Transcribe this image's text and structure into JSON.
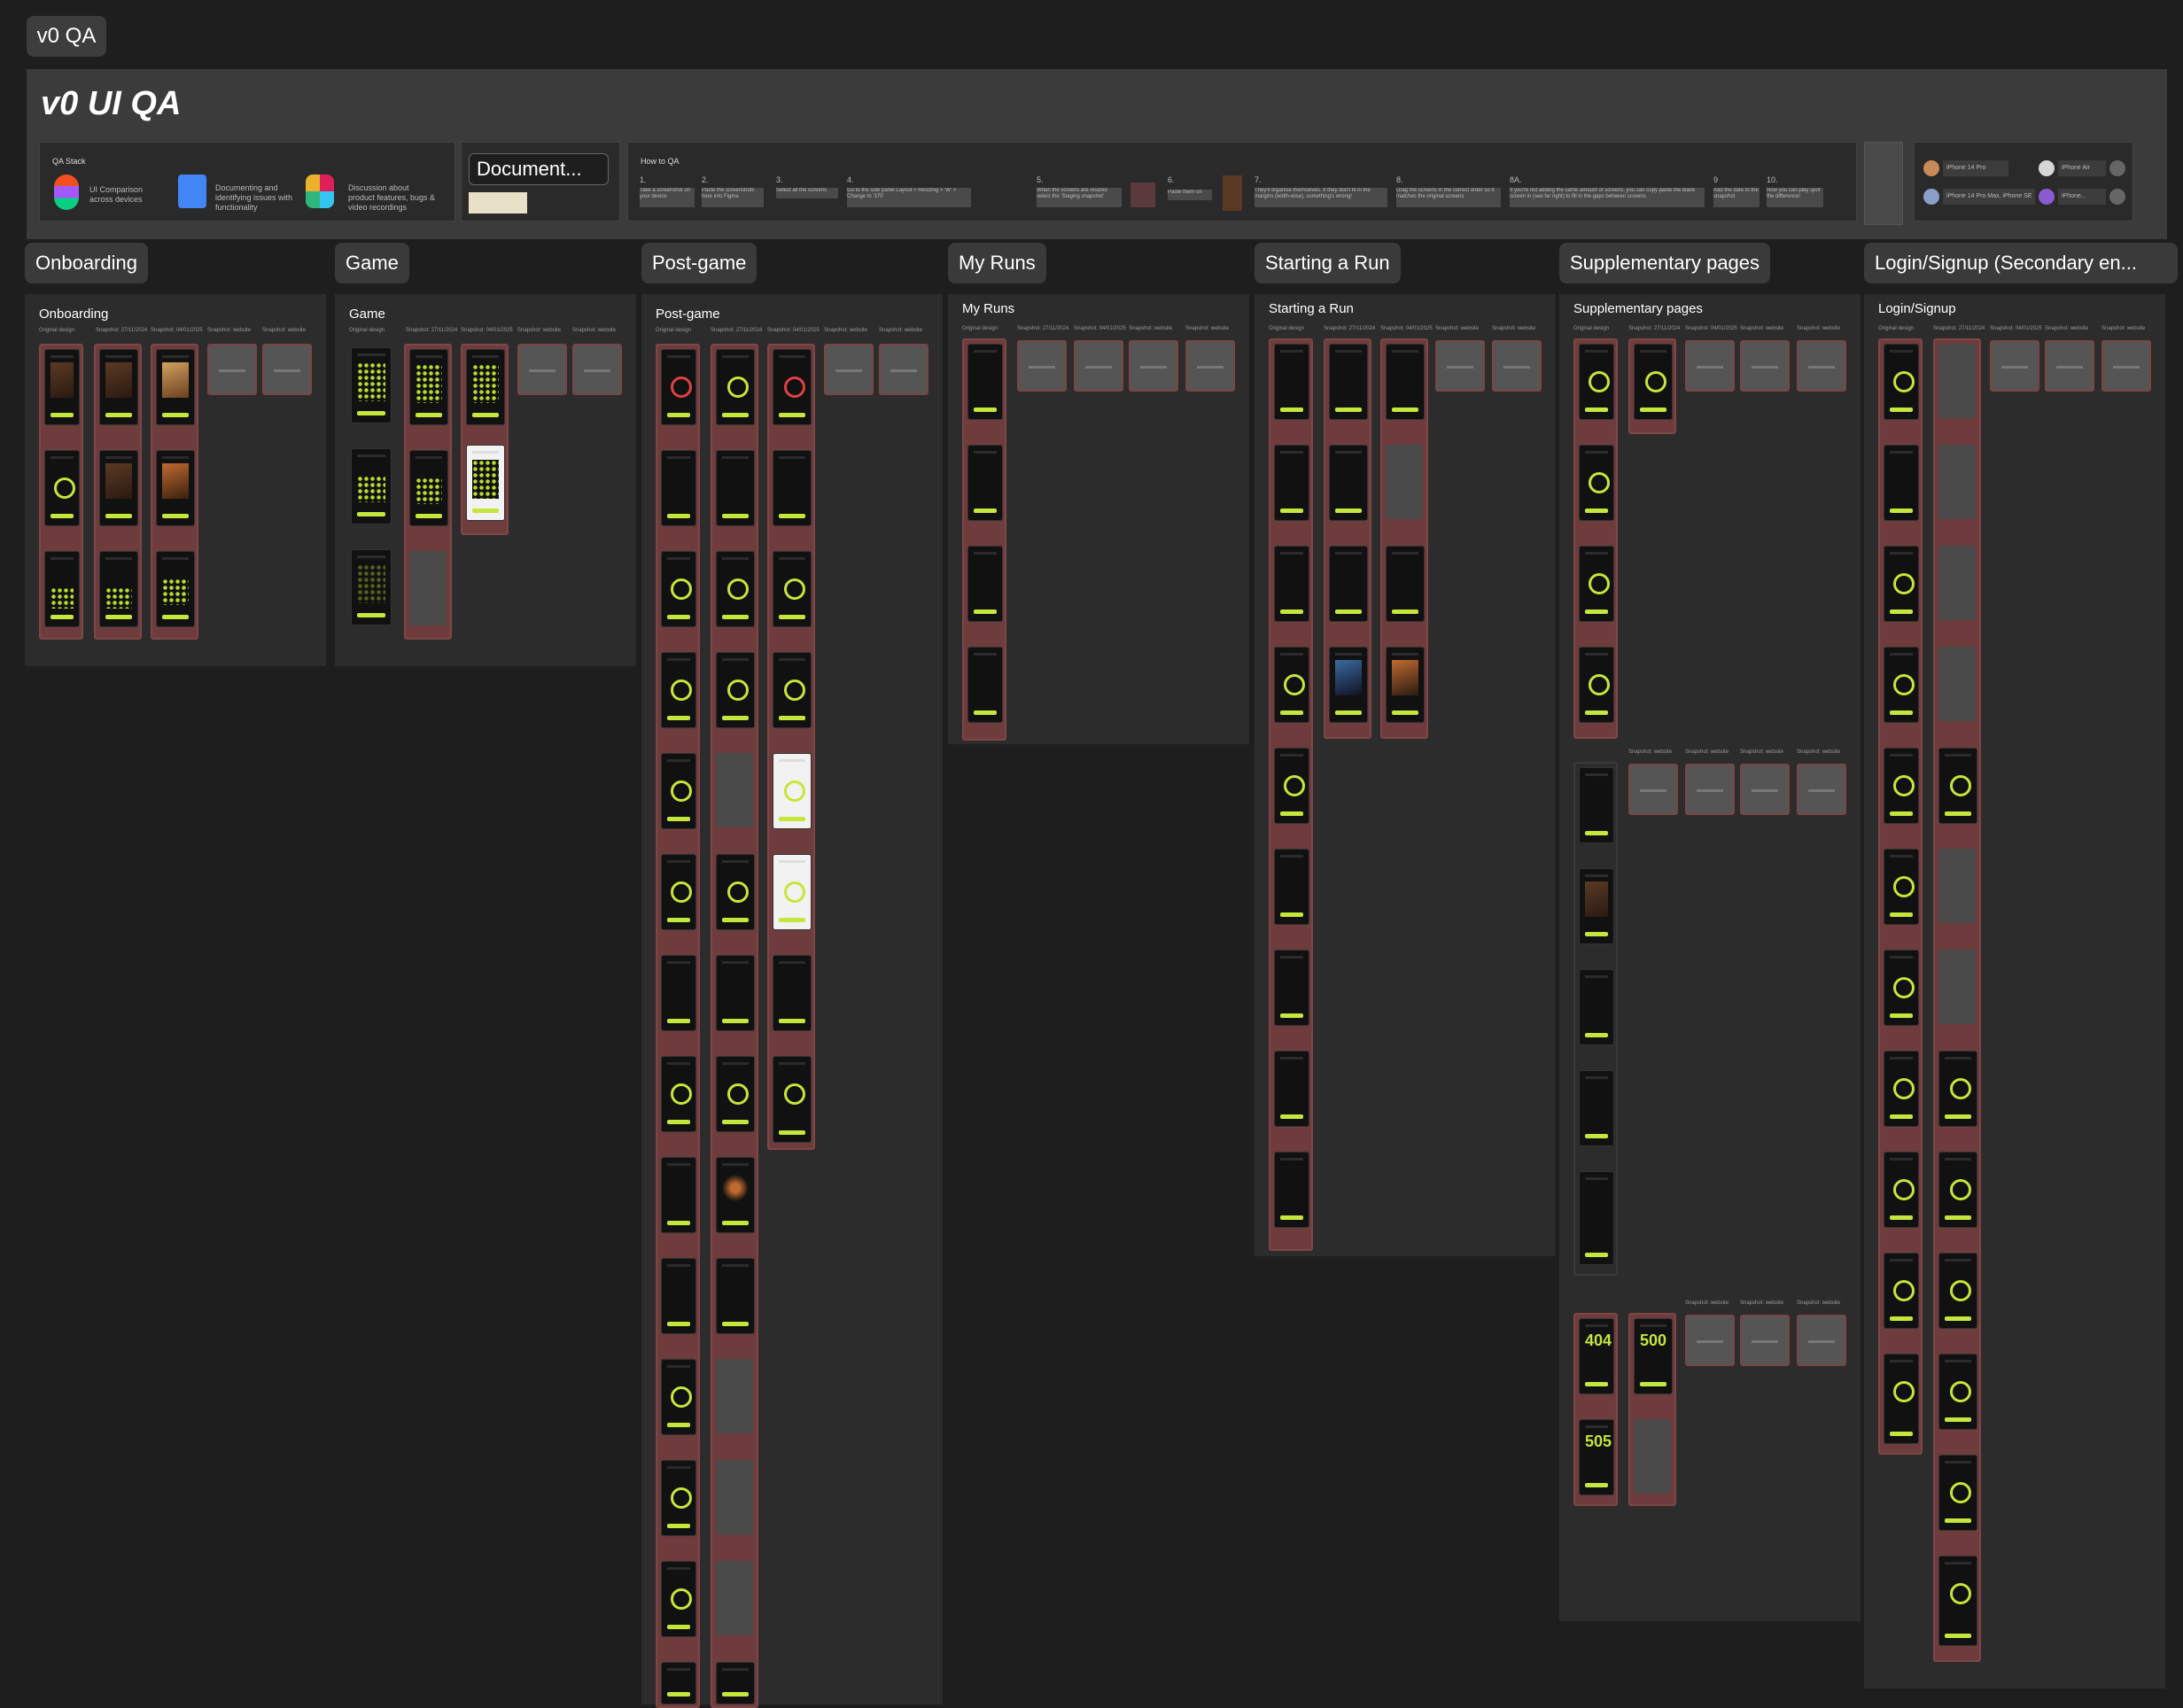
{
  "page": {
    "tag": "v0 QA"
  },
  "banner": {
    "title": "v0 UI QA",
    "qa_stack": {
      "title": "QA Stack",
      "tools": [
        {
          "icon": "figma-icon",
          "desc": "UI Comparison across devices"
        },
        {
          "icon": "google-docs-icon",
          "desc": "Documenting and identifying issues with functionality"
        },
        {
          "icon": "slack-icon",
          "desc": "Discussion about product features, bugs & video recordings"
        }
      ]
    },
    "document": {
      "label": "Document..."
    },
    "how_to": {
      "title": "How to QA",
      "steps": [
        {
          "num": "1.",
          "text": "Take a screenshot on your device"
        },
        {
          "num": "2.",
          "text": "Paste the screenshots here into Figma"
        },
        {
          "num": "3.",
          "text": "Select all the screens"
        },
        {
          "num": "4.",
          "text": "Go to the side panel Layout > Resizing > 'W' > Change to '375'"
        },
        {
          "num": "5.",
          "text": "When the screens are resized select the 'Staging snapshot'"
        },
        {
          "num": "6.",
          "text": "Paste them on"
        },
        {
          "num": "7.",
          "text": "They'll organise themselves. If they don't fit in the margins (width-wise), something's wrong!"
        },
        {
          "num": "8.",
          "text": "Drag the screens in the correct order so it matches the original screens"
        },
        {
          "num": "8A.",
          "text": "If you're not adding the same amount of screens, you can copy paste the blank screen in (see far right) to fill in the gaps between screens"
        },
        {
          "num": "9",
          "text": "Add the date to the snapshot"
        },
        {
          "num": "10.",
          "text": "Now you can play spot the difference!"
        }
      ]
    },
    "devices": [
      {
        "label": "iPhone 14 Pro"
      },
      {
        "label": "iPhone Air"
      },
      {
        "label": "iPhone 14 Pro Max, iPhone SE"
      },
      {
        "label": "iPhone..."
      }
    ]
  },
  "sections": [
    {
      "tag": "Onboarding",
      "panel_title": "Onboarding"
    },
    {
      "tag": "Game",
      "panel_title": "Game"
    },
    {
      "tag": "Post-game",
      "panel_title": "Post-game"
    },
    {
      "tag": "My Runs",
      "panel_title": "My Runs"
    },
    {
      "tag": "Starting a Run",
      "panel_title": "Starting a Run"
    },
    {
      "tag": "Supplementary pages",
      "panel_title": "Supplementary pages"
    },
    {
      "tag": "Login/Signup (Secondary en...",
      "panel_title": "Login/Signup"
    }
  ],
  "column_headers": {
    "original": "Original design",
    "snapshot_a": "Snapshot: 27/11/2024",
    "snapshot_b": "Snapshot: 04/01/2025",
    "snapshot_c": "Snapshot: website",
    "snapshot_d": "Snapshot: website"
  },
  "error_codes": {
    "e404": "404",
    "e500": "500",
    "e505": "505"
  },
  "colors": {
    "accent": "#c5e63a",
    "column_frame": "#6e3c3c",
    "panel": "#2c2c2c"
  }
}
